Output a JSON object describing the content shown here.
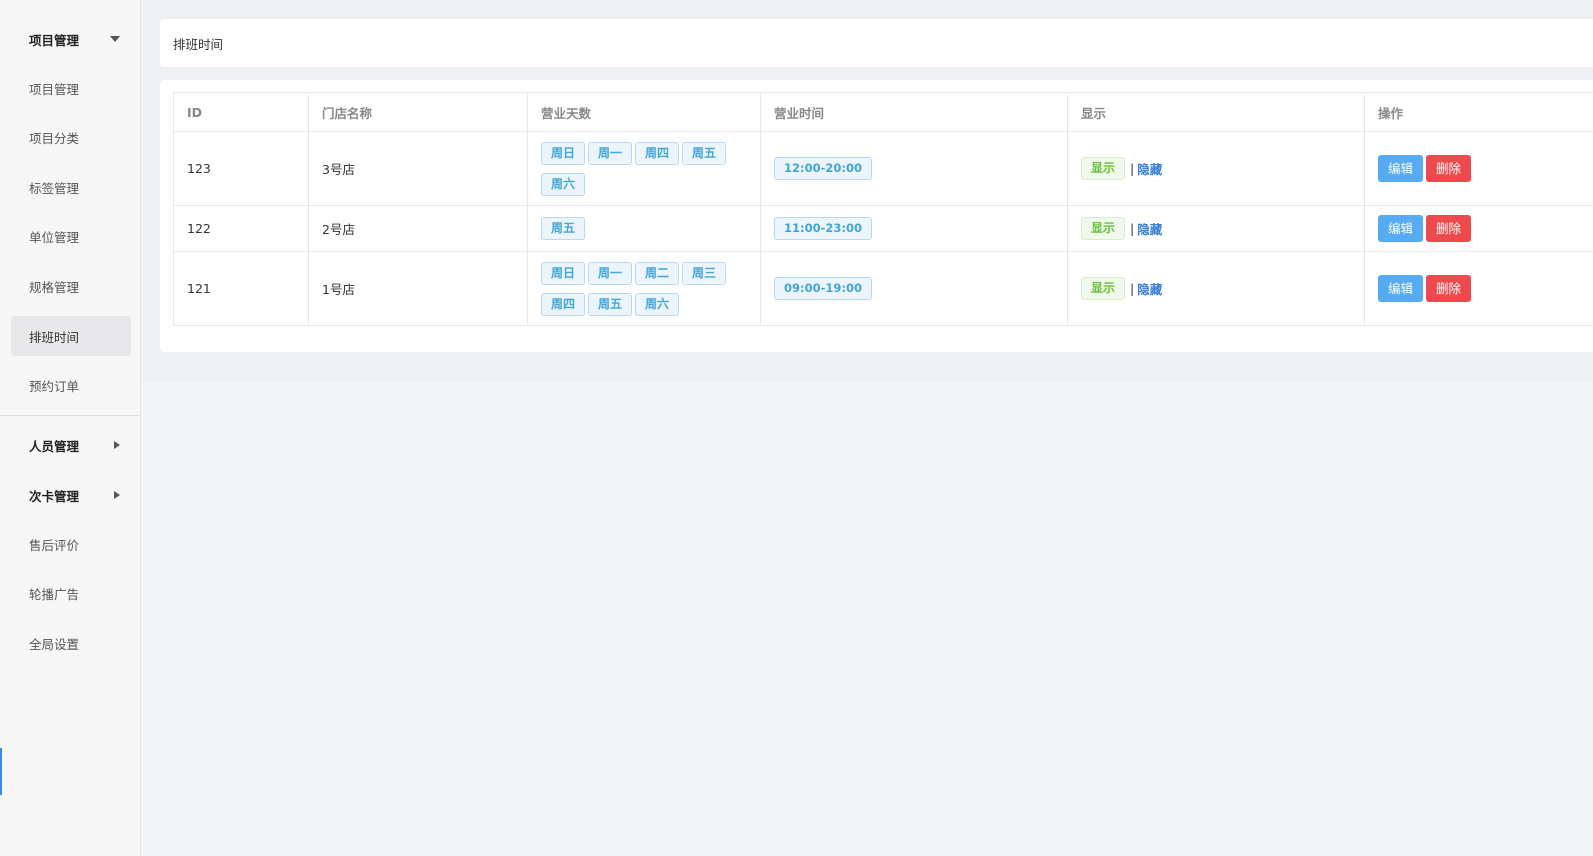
{
  "sidebar": {
    "groups": [
      {
        "label": "项目管理",
        "expanded": true
      },
      {
        "label": "人员管理",
        "expanded": false
      },
      {
        "label": "次卡管理",
        "expanded": false
      }
    ],
    "sub_items": [
      "项目管理",
      "项目分类",
      "标签管理",
      "单位管理",
      "规格管理",
      "排班时间",
      "预约订单"
    ],
    "active_item": "排班时间",
    "bottom_items": [
      "售后评价",
      "轮播广告",
      "全局设置"
    ]
  },
  "page": {
    "title": "排班时间"
  },
  "table": {
    "headers": [
      "ID",
      "门店名称",
      "营业天数",
      "营业时间",
      "显示",
      "操作"
    ],
    "rows": [
      {
        "id": "123",
        "store": "3号店",
        "days": [
          "周日",
          "周一",
          "周四",
          "周五",
          "周六"
        ],
        "hours": "12:00-20:00",
        "show": "显示",
        "hide": "隐藏",
        "edit": "编辑",
        "delete": "删除"
      },
      {
        "id": "122",
        "store": "2号店",
        "days": [
          "周五"
        ],
        "hours": "11:00-23:00",
        "show": "显示",
        "hide": "隐藏",
        "edit": "编辑",
        "delete": "删除"
      },
      {
        "id": "121",
        "store": "1号店",
        "days": [
          "周日",
          "周一",
          "周二",
          "周三",
          "周四",
          "周五",
          "周六"
        ],
        "hours": "09:00-19:00",
        "show": "显示",
        "hide": "隐藏",
        "edit": "编辑",
        "delete": "删除"
      }
    ],
    "separator": "|"
  },
  "colors": {
    "tag_blue": "#42a5d8",
    "tag_green": "#67c23a",
    "edit_button": "#56abf2",
    "delete_button": "#ee4a4e",
    "link_blue": "#3b7fd4"
  }
}
